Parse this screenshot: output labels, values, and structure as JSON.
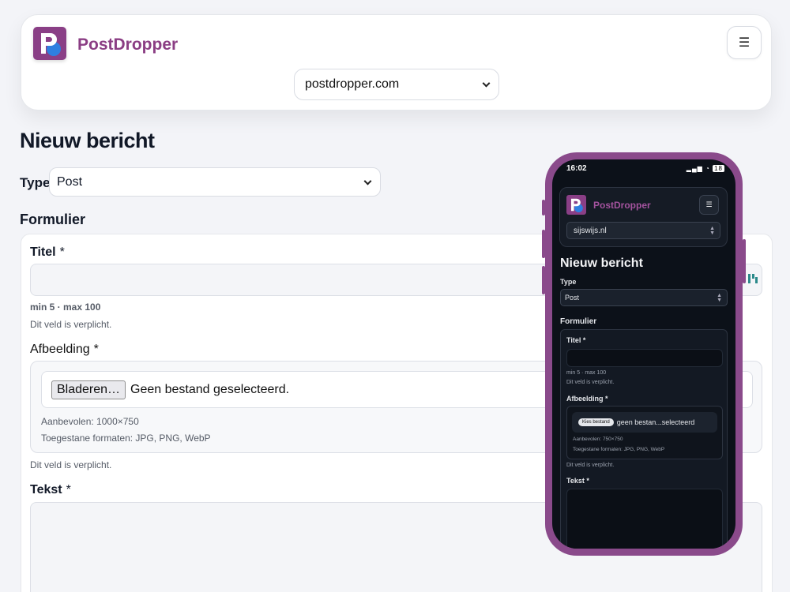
{
  "app": {
    "name": "PostDropper",
    "logo_letter": "P"
  },
  "header": {
    "site_select": "postdropper.com",
    "menu_icon": "☰"
  },
  "page": {
    "title": "Nieuw bericht"
  },
  "type_field": {
    "label": "Type",
    "value": "Post"
  },
  "form": {
    "section_title": "Formulier",
    "title_field": {
      "label": "Titel",
      "required": "*",
      "hint": "min 5 · max 100",
      "error": "Dit veld is verplicht."
    },
    "image_field": {
      "label": "Afbeelding",
      "required": "*",
      "browse_button": "Bladeren…",
      "no_file": "Geen bestand geselecteerd.",
      "recommended": "Aanbevolen: 1000×750",
      "formats": "Toegestane formaten: JPG, PNG, WebP",
      "error": "Dit veld is verplicht."
    },
    "text_field": {
      "label": "Tekst",
      "required": "*"
    }
  },
  "colors": {
    "brand": "#8b3e84",
    "phone_frame": "#8a4a8b",
    "phone_bg": "#0c1119"
  },
  "phone": {
    "time": "16:02",
    "battery": "18",
    "app_name": "PostDropper",
    "menu_icon": "☰",
    "site_select": "sijswijs.nl",
    "title": "Nieuw bericht",
    "type_label": "Type",
    "type_value": "Post",
    "section_title": "Formulier",
    "title_label": "Titel *",
    "title_hint": "min 5 · max 100",
    "title_error": "Dit veld is verplicht.",
    "image_label": "Afbeelding *",
    "browse_button": "Kies bestand",
    "no_file": "geen bestan...selecteerd",
    "recommended": "Aanbevolen: 750×750",
    "formats": "Toegestane formaten: JPG, PNG, WebP",
    "image_error": "Dit veld is verplicht.",
    "text_label": "Tekst *"
  }
}
